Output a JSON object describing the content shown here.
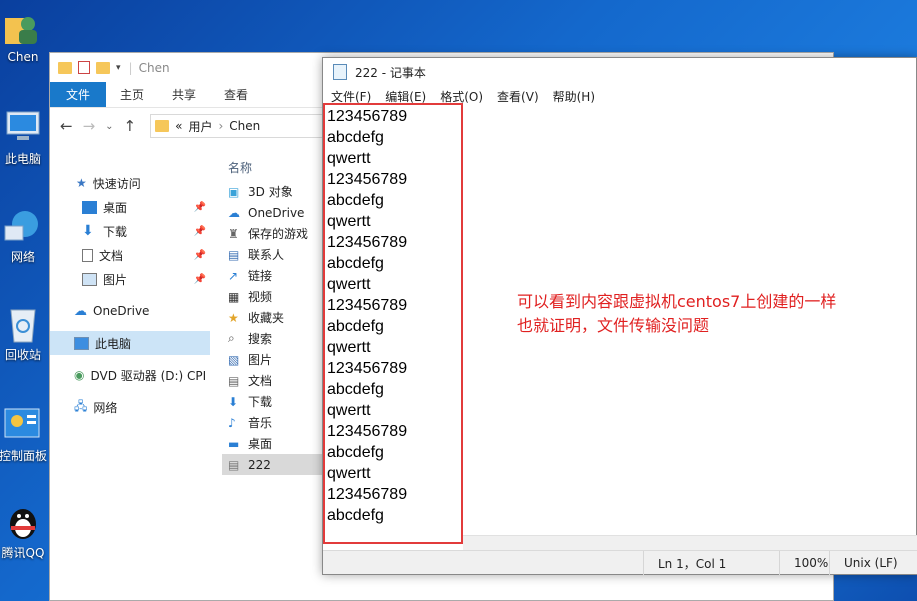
{
  "desktop": {
    "icons": [
      {
        "label": "Chen",
        "icon": "user-folder-icon"
      },
      {
        "label": "此电脑",
        "icon": "computer-icon"
      },
      {
        "label": "网络",
        "icon": "network-icon"
      },
      {
        "label": "回收站",
        "icon": "recycle-bin-icon"
      },
      {
        "label": "控制面板",
        "icon": "control-panel-icon"
      },
      {
        "label": "腾讯QQ",
        "icon": "qq-icon"
      }
    ]
  },
  "explorer": {
    "title": "Chen",
    "ribbon_tabs": [
      "文件",
      "主页",
      "共享",
      "查看"
    ],
    "breadcrumb": [
      "«",
      "用户",
      "›",
      "Chen"
    ],
    "nav": {
      "quick_access": "快速访问",
      "items": [
        {
          "label": "桌面",
          "pinned": true
        },
        {
          "label": "下载",
          "pinned": true
        },
        {
          "label": "文档",
          "pinned": true
        },
        {
          "label": "图片",
          "pinned": true
        }
      ],
      "onedrive": "OneDrive",
      "this_pc": "此电脑",
      "dvd": "DVD 驱动器 (D:) CPI",
      "network": "网络"
    },
    "content": {
      "column_name": "名称",
      "files": [
        "3D 对象",
        "OneDrive",
        "保存的游戏",
        "联系人",
        "链接",
        "视频",
        "收藏夹",
        "搜索",
        "图片",
        "文档",
        "下载",
        "音乐",
        "桌面",
        "222"
      ]
    }
  },
  "notepad": {
    "title": "222 - 记事本",
    "menu": [
      "文件(F)",
      "编辑(E)",
      "格式(O)",
      "查看(V)",
      "帮助(H)"
    ],
    "lines": [
      "123456789",
      "abcdefg",
      "qwertt",
      "123456789",
      "abcdefg",
      "qwertt",
      "123456789",
      "abcdefg",
      "qwertt",
      "123456789",
      "abcdefg",
      "qwertt",
      "123456789",
      "abcdefg",
      "qwertt",
      "123456789",
      "abcdefg",
      "qwertt",
      "123456789",
      "abcdefg"
    ],
    "status": {
      "position": "Ln 1，Col 1",
      "zoom": "100%",
      "eol": "Unix (LF)"
    }
  },
  "annotation": {
    "line1": "可以看到内容跟虚拟机centos7上创建的一样",
    "line2": "也就证明，文件传输没问题",
    "color": "#e02020"
  }
}
